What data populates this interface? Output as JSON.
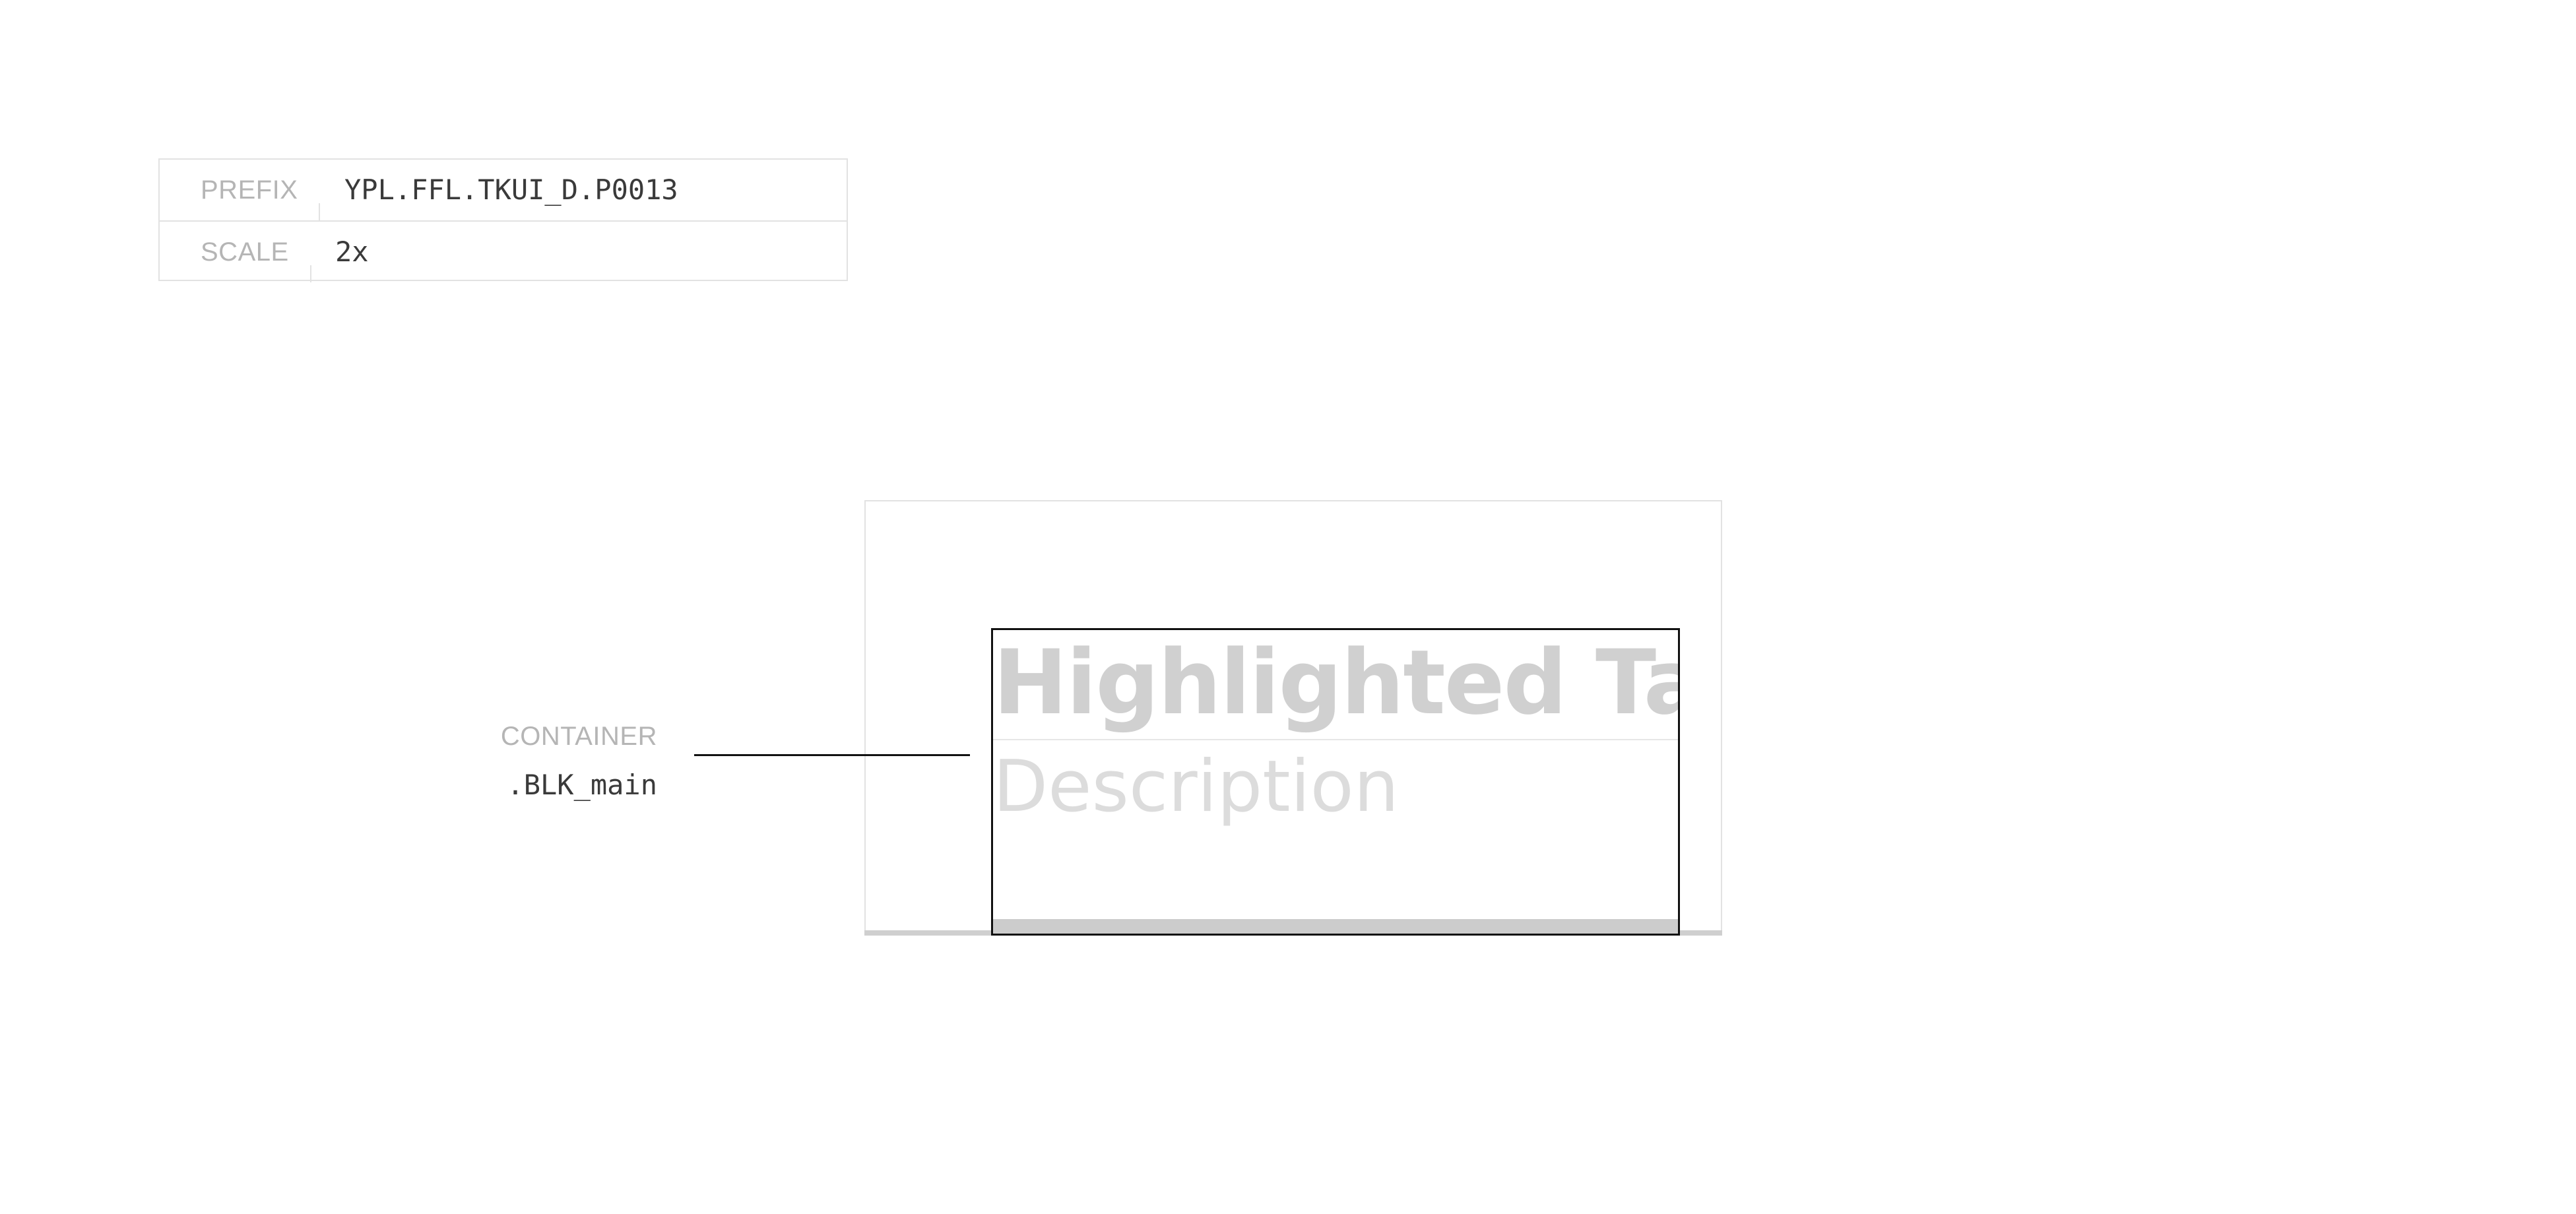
{
  "meta": {
    "rows": [
      {
        "label": "PREFIX",
        "value": "YPL.FFL.TKUI_D.P0013"
      },
      {
        "label": "SCALE",
        "value": "2x"
      }
    ]
  },
  "component": {
    "title": "Highlighted Tab",
    "description": "Description"
  },
  "annotation": {
    "label": "CONTAINER",
    "class_name": ".BLK_main"
  },
  "colors": {
    "border_light": "#e2e2e2",
    "container_outline": "#111111",
    "title_text": "#d0d0d0",
    "description_text": "#dcdcdc",
    "underline": "#cccccc",
    "label_text": "#b5b5b5",
    "value_text": "#3a3a3a"
  }
}
